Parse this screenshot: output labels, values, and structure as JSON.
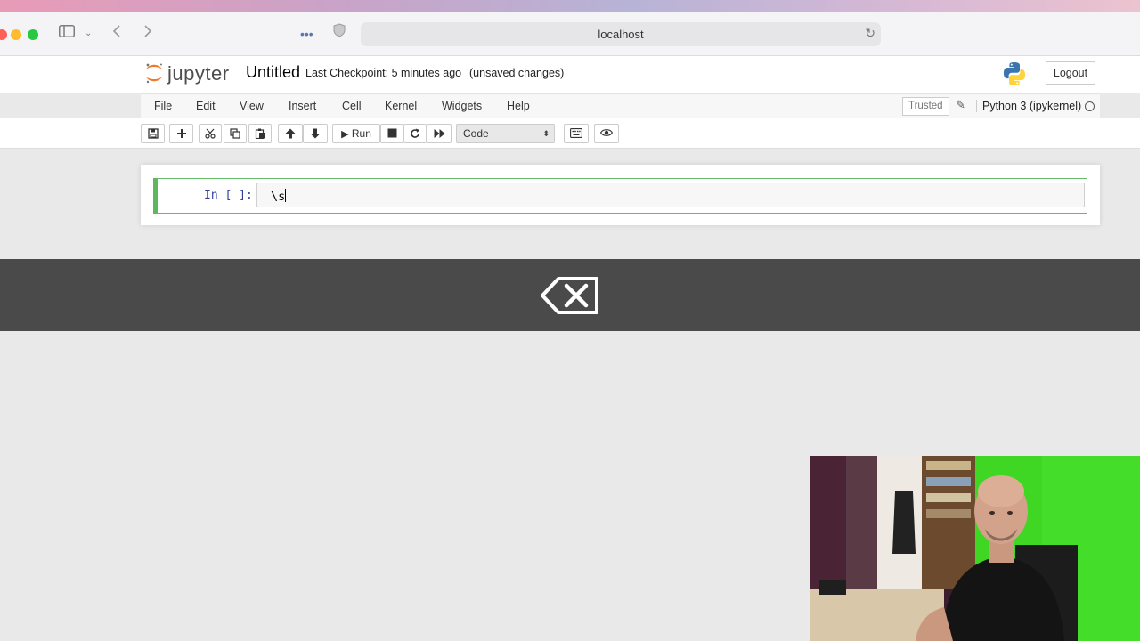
{
  "browser": {
    "url": "localhost",
    "icons": [
      "sidebar-icon",
      "chevron-down-icon",
      "back-icon",
      "forward-icon",
      "more-icon",
      "shield-icon",
      "reload-icon"
    ]
  },
  "header": {
    "logo_text": "jupyter",
    "notebook_title": "Untitled",
    "checkpoint": "Last Checkpoint: 5 minutes ago",
    "unsaved": "(unsaved changes)",
    "logout_label": "Logout"
  },
  "menubar": {
    "items": [
      "File",
      "Edit",
      "View",
      "Insert",
      "Cell",
      "Kernel",
      "Widgets",
      "Help"
    ],
    "trusted": "Trusted",
    "kernel": "Python 3 (ipykernel)"
  },
  "toolbar": {
    "run_label": "Run",
    "cell_type": "Code"
  },
  "cell": {
    "prompt": "In [ ]:",
    "code": "\\s"
  },
  "colors": {
    "jupyter_orange": "#f37726",
    "cell_selected_border": "#66bb6a",
    "overlay_band": "#4a4a4a",
    "webcam_green": "#3fd624"
  }
}
